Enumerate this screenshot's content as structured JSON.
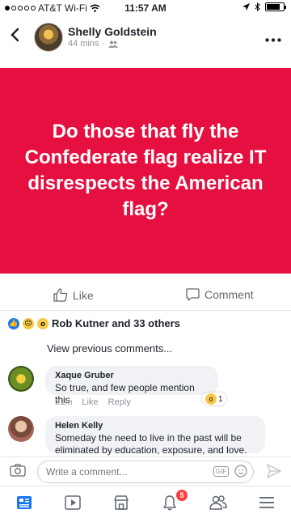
{
  "status_bar": {
    "carrier": "AT&T Wi-Fi",
    "time": "11:57 AM"
  },
  "post": {
    "author": "Shelly Goldstein",
    "time_ago": "44 mins",
    "text": "Do those that fly the Confederate flag realize IT disrespects the American flag?",
    "background_color": "#e5103f",
    "actions": {
      "like": "Like",
      "comment": "Comment"
    },
    "reactions_summary": "Rob Kutner and 33 others"
  },
  "comments": {
    "view_previous": "View previous comments...",
    "items": [
      {
        "author": "Xaque Gruber",
        "text": "So true, and few people mention this",
        "time": "31m",
        "like_label": "Like",
        "reply_label": "Reply",
        "reaction_count": "1"
      },
      {
        "author": "Helen Kelly",
        "text": "Someday the need to live in the past will be eliminated by education, exposure, and love."
      }
    ]
  },
  "composer": {
    "placeholder": "Write a comment...",
    "gif_label": "GIF"
  },
  "tab_bar": {
    "notifications_badge": "5"
  },
  "colors": {
    "accent": "#1877f2",
    "badge": "#fa3e3e"
  }
}
